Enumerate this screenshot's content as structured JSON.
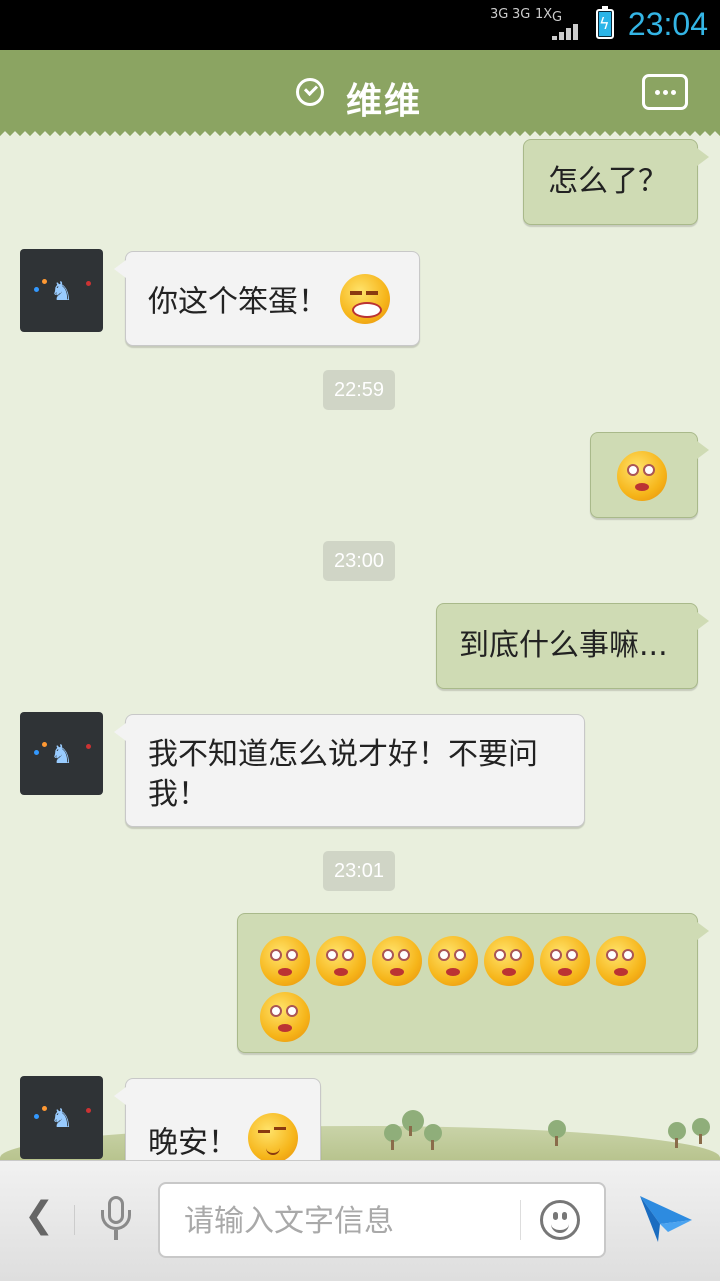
{
  "status_bar": {
    "time": "23:04",
    "net_a": "3G",
    "net_b": "3G",
    "net_c": "1X",
    "net_d": "G",
    "battery_color": "#2bb5e8",
    "clock_color": "#34b5e5"
  },
  "header": {
    "title": "维维",
    "status_icon": "check-circle-icon",
    "menu_icon": "chat-menu-icon",
    "bg_color": "#8ba462"
  },
  "messages": [
    {
      "side": "out",
      "text": "怎么了？"
    },
    {
      "side": "in",
      "text": "你这个笨蛋！",
      "emoji": "laughing-face-icon"
    },
    {
      "type": "time",
      "text": "22:59"
    },
    {
      "side": "out",
      "emoji": "dizzy-face-icon"
    },
    {
      "type": "time",
      "text": "23:00"
    },
    {
      "side": "out",
      "text": "到底什么事嘛..."
    },
    {
      "side": "in",
      "text": "我不知道怎么说才好！不要问我！"
    },
    {
      "type": "time",
      "text": "23:01"
    },
    {
      "side": "out",
      "emoji_count": 8,
      "emoji": "dizzy-face-icon"
    },
    {
      "side": "in",
      "text": "晚安！",
      "emoji": "smirk-face-icon"
    }
  ],
  "input_bar": {
    "placeholder": "请输入文字信息",
    "voice_icon": "microphone-icon",
    "emoji_icon": "smiley-icon",
    "send_icon": "send-icon",
    "back_icon": "back-arrow-icon"
  }
}
